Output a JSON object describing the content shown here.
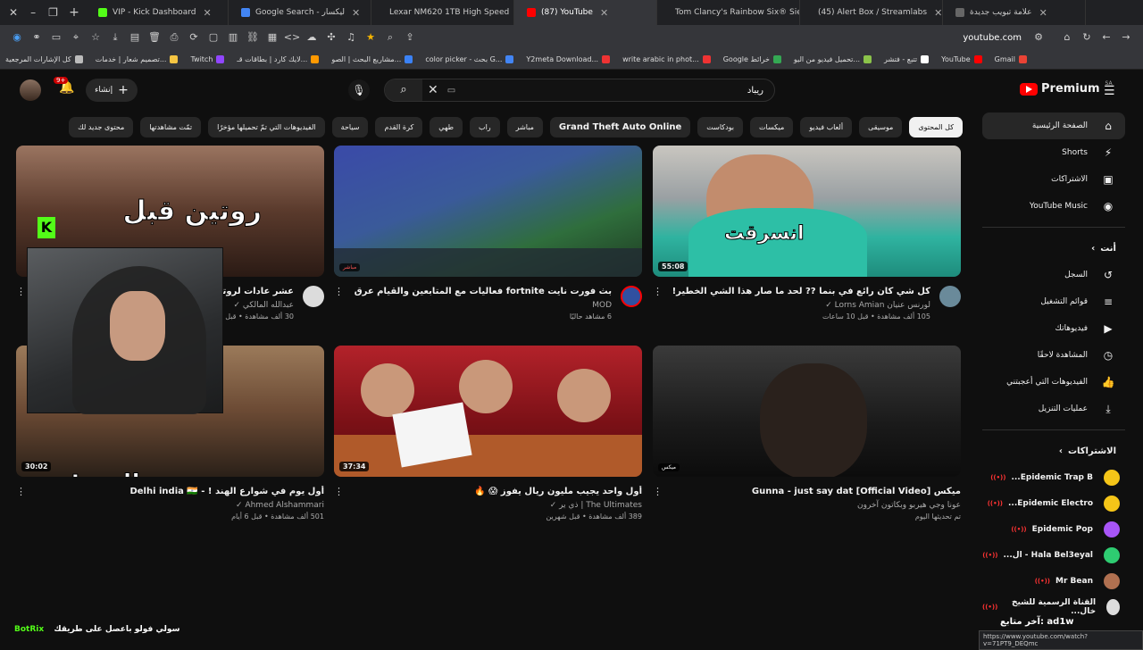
{
  "browser": {
    "tabs": [
      {
        "title": "علامة تبويب جديدة",
        "active": false,
        "color": "#666"
      },
      {
        "title": "(45) Alert Box / Streamlabs",
        "active": false,
        "color": "#31c3a2"
      },
      {
        "title": "Tom Clancy's Rainbow Six® Sie",
        "active": false,
        "color": "#4a7bd1"
      },
      {
        "title": "(87) YouTube",
        "active": true,
        "color": "#ff0000"
      },
      {
        "title": "Lexar NM620 1TB High Speed",
        "active": false,
        "color": "#aaa"
      },
      {
        "title": "Google Search - ليكسار",
        "active": false,
        "color": "#4285f4"
      },
      {
        "title": "VIP - Kick Dashboard",
        "active": false,
        "color": "#53fc18"
      }
    ],
    "url": "youtube.com",
    "bookmarks": [
      {
        "label": "كل الإشارات المرجعية",
        "color": "#bbb"
      },
      {
        "label": "تصميم شعار | خدمات...",
        "color": "#f5c542"
      },
      {
        "label": "Twitch",
        "color": "#9146ff"
      },
      {
        "label": "لايك كارد | بطاقات قـ...",
        "color": "#f90"
      },
      {
        "label": "مشاريع البحث | الصو...",
        "color": "#3b82f6"
      },
      {
        "label": "color picker - بحث G...",
        "color": "#4285f4"
      },
      {
        "label": "Y2meta Download...",
        "color": "#e33"
      },
      {
        "label": "write arabic in phot...",
        "color": "#e33"
      },
      {
        "label": "Google خرائط",
        "color": "#34a853"
      },
      {
        "label": "تحميل فيديو من اليو...",
        "color": "#8bc34a"
      },
      {
        "label": "تتبع - فتشر",
        "color": "#fff"
      },
      {
        "label": "YouTube",
        "color": "#ff0000"
      },
      {
        "label": "Gmail",
        "color": "#ea4335"
      }
    ]
  },
  "masthead": {
    "notif_count": "9+",
    "create_label": "إنشاء",
    "search_value": "ريباد",
    "logo_text": "Premium",
    "region": "SA"
  },
  "chips": [
    "كل المحتوى",
    "موسيقى",
    "ألعاب فيديو",
    "ميكسات",
    "بودكاست",
    "Grand Theft Auto Online",
    "مباشر",
    "راب",
    "طهي",
    "كرة القدم",
    "سياحة",
    "الفيديوهات التي تمّ تحميلها مؤخرًا",
    "تمّت مشاهدتها",
    "محتوى جديد لك"
  ],
  "videos": [
    {
      "title": "كل شي كان رائع في بنما ?? لحد ما صار هذا الشي الخطير!",
      "channel": "لورنس عنيان Lorns Amian ✓",
      "stats": "105 ألف مشاهدة • قبل 10 ساعات",
      "duration": "55:08",
      "thumb_text": "انسرقت"
    },
    {
      "title": "بث فورت نايت fortnite فعاليات مع المتابعين والقيام عرق",
      "channel": "MOD",
      "stats": "6 مشاهد حاليًا",
      "duration": "مباشر",
      "thumb_text": ""
    },
    {
      "title": "عشر عادات لروتين قبل النوم",
      "channel": "عبدالله المالكي ✓",
      "stats": "30 ألف مشاهدة • قبل يومين",
      "duration": "",
      "thumb_text": "روتين قبل"
    },
    {
      "title": "ميكس Gunna - just say dat [Official Video]",
      "channel": "عونا وجي هيربو وبكاتون آخرون",
      "stats": "تم تحديثها اليوم",
      "duration": "ميكس",
      "thumb_text": ""
    },
    {
      "title": "أول واحد يجيب مليون ريال يفوز 😱 🔥",
      "channel": "The Ultimates | ذي ير ✓",
      "stats": "389 ألف مشاهدة • قبل شهرين",
      "duration": "37:34",
      "thumb_text": ""
    },
    {
      "title": "أول يوم في شوارع الهند ! - Delhi india 🇮🇳",
      "channel": "Ahmed Alshammari ✓",
      "stats": "501 ألف مشاهدة • قبل 6 أيام",
      "duration": "30:02",
      "thumb_text": "صدمتني الهند!"
    }
  ],
  "sidebar": {
    "main": [
      {
        "label": "الصفحة الرئيسية",
        "icon": "home-icon",
        "glyph": "⌂",
        "active": true
      },
      {
        "label": "Shorts",
        "icon": "shorts-icon",
        "glyph": "⚡",
        "active": false
      },
      {
        "label": "الاشتراكات",
        "icon": "subscriptions-icon",
        "glyph": "▣",
        "active": false
      },
      {
        "label": "YouTube Music",
        "icon": "music-icon",
        "glyph": "◉",
        "active": false
      }
    ],
    "you_label": "أنت",
    "you": [
      {
        "label": "السجل",
        "icon": "history-icon",
        "glyph": "↺"
      },
      {
        "label": "قوائم التشغيل",
        "icon": "playlists-icon",
        "glyph": "≡"
      },
      {
        "label": "فيديوهاتك",
        "icon": "your-videos-icon",
        "glyph": "▶"
      },
      {
        "label": "المشاهدة لاحقًا",
        "icon": "watch-later-icon",
        "glyph": "◷"
      },
      {
        "label": "الفيديوهات التي أعجبتني",
        "icon": "liked-icon",
        "glyph": "👍"
      },
      {
        "label": "عمليات التنزيل",
        "icon": "download-icon",
        "glyph": "⤓"
      }
    ],
    "subs_label": "الاشتراكات",
    "subs": [
      {
        "name": "Epidemic Trap B...",
        "color": "#f5c518"
      },
      {
        "name": "Epidemic Electro...",
        "color": "#f5c518"
      },
      {
        "name": "Epidemic Pop",
        "color": "#a855f7"
      },
      {
        "name": "Hala Bel3eyal - ال...",
        "color": "#2ecc71"
      },
      {
        "name": "Mr Bean",
        "color": "#b07050"
      },
      {
        "name": "القناة الرسمية للشيخ خال...",
        "color": "#ddd"
      }
    ]
  },
  "overlays": {
    "kick_text": "سولي فولو باعصل على طريقك",
    "kick_brand": "BotRix",
    "last_follower": "آخر متابع: ad1w",
    "status_url": "https://www.youtube.com/watch?v=71PT9_DEQmc"
  }
}
